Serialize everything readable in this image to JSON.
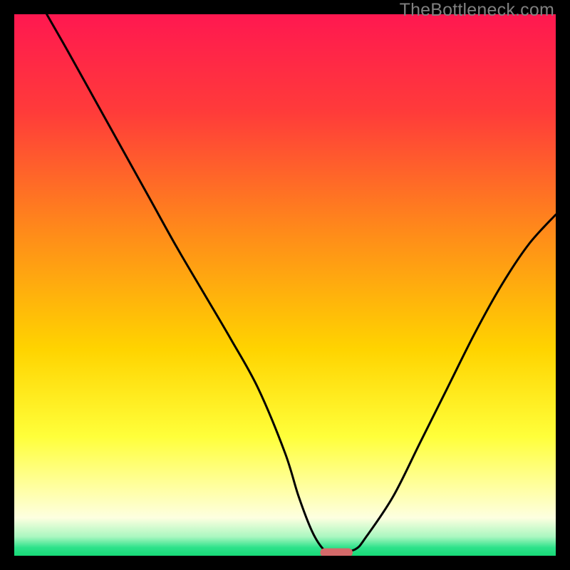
{
  "watermark": "TheBottleneck.com",
  "colors": {
    "gradient_stops": [
      {
        "offset": 0.0,
        "color": "#ff1850"
      },
      {
        "offset": 0.18,
        "color": "#ff3b3a"
      },
      {
        "offset": 0.4,
        "color": "#ff8a1a"
      },
      {
        "offset": 0.62,
        "color": "#ffd400"
      },
      {
        "offset": 0.78,
        "color": "#ffff3a"
      },
      {
        "offset": 0.88,
        "color": "#ffffa8"
      },
      {
        "offset": 0.93,
        "color": "#fdffe0"
      },
      {
        "offset": 0.965,
        "color": "#aaf7c0"
      },
      {
        "offset": 0.985,
        "color": "#2de28a"
      },
      {
        "offset": 1.0,
        "color": "#17d977"
      }
    ],
    "curve": "#000000",
    "marker": "#d46a6a",
    "frame": "#000000"
  },
  "chart_data": {
    "type": "line",
    "title": "",
    "xlabel": "",
    "ylabel": "",
    "xlim": [
      0,
      100
    ],
    "ylim": [
      0,
      100
    ],
    "grid": false,
    "series": [
      {
        "name": "bottleneck-curve",
        "x": [
          6,
          10,
          15,
          20,
          25,
          30,
          35,
          40,
          45,
          50,
          52.5,
          55,
          57,
          58.5,
          60,
          63,
          65,
          70,
          75,
          80,
          85,
          90,
          95,
          100
        ],
        "y": [
          100,
          93,
          84,
          75,
          66,
          57,
          48.5,
          40,
          31,
          19,
          11,
          4.5,
          1.3,
          0.6,
          0.6,
          1.2,
          3.5,
          11,
          21,
          31,
          41,
          50,
          57.5,
          63
        ]
      }
    ],
    "annotations": [
      {
        "name": "optimal-marker",
        "x_range": [
          56.5,
          62.5
        ],
        "y": 0.6
      }
    ],
    "legend": false
  }
}
